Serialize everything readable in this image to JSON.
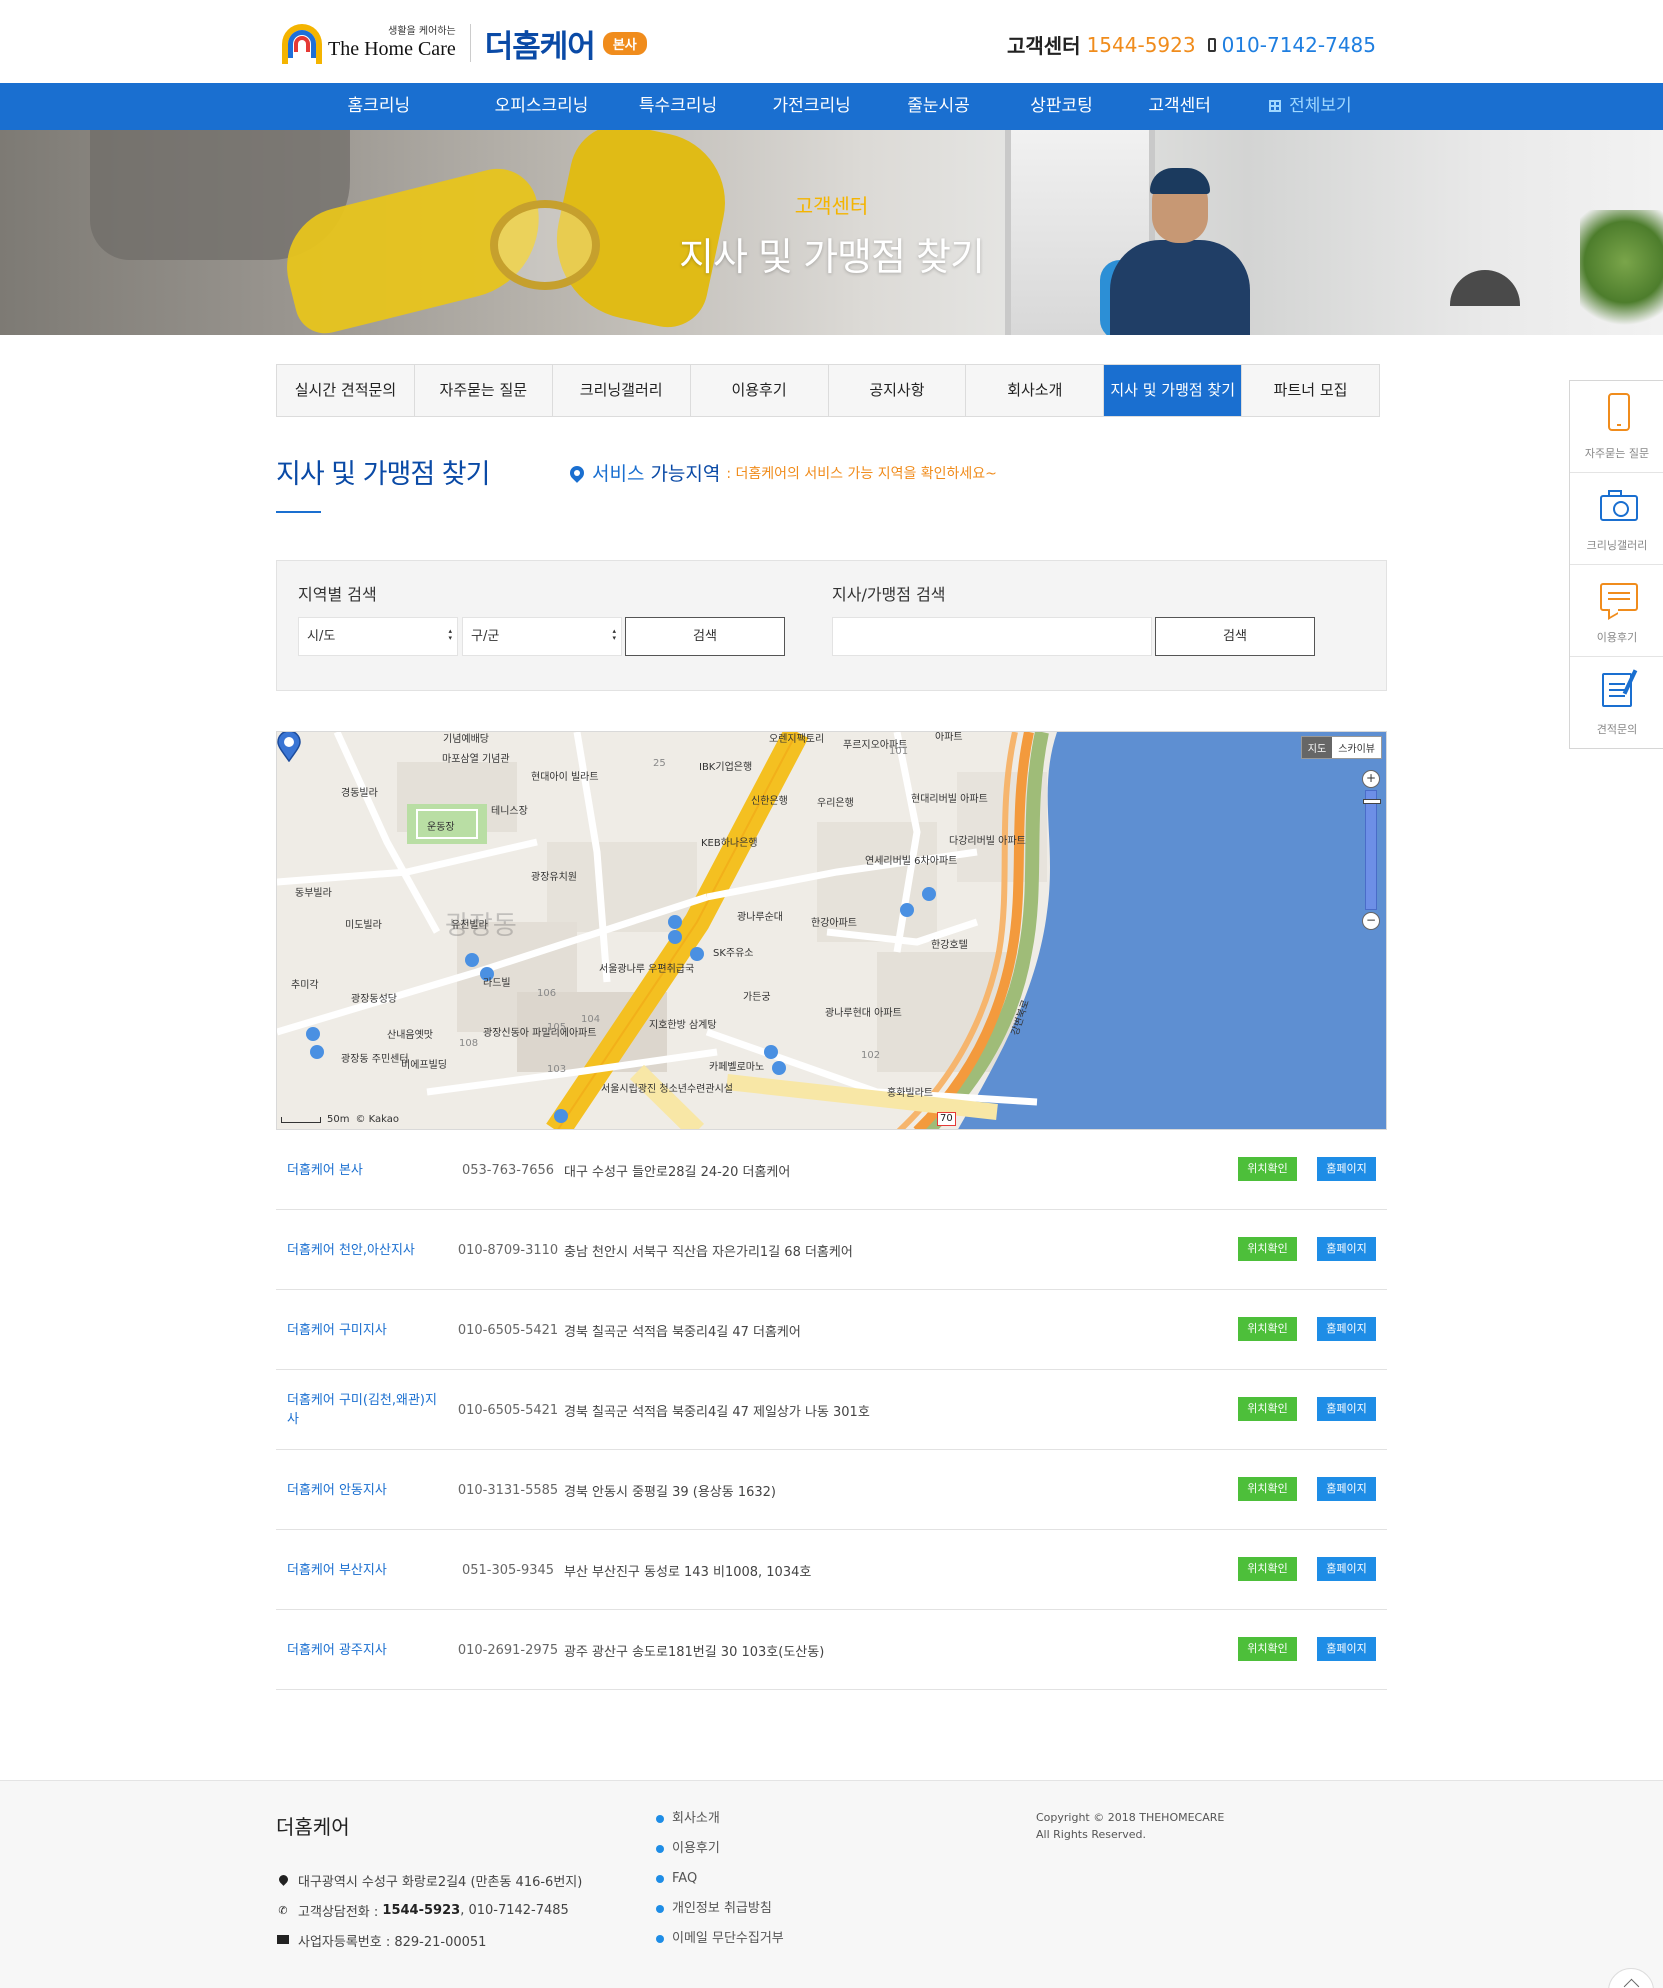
{
  "header": {
    "logo_small": "생활을 케어하는",
    "logo_en": "The Home Care",
    "logo_ko": "더홈케어",
    "logo_badge": "본사",
    "cs_label": "고객센터",
    "cs_number": "1544-5923",
    "cs_mobile": "010-7142-7485"
  },
  "nav": {
    "items": [
      "홈크리닝",
      "오피스크리닝",
      "특수크리닝",
      "가전크리닝",
      "줄눈시공",
      "상판코팅",
      "고객센터"
    ],
    "all_label": "전체보기"
  },
  "banner": {
    "subtitle": "고객센터",
    "title": "지사 및 가맹점 찾기"
  },
  "tabs": [
    "실시간 견적문의",
    "자주묻는 질문",
    "크리닝갤러리",
    "이용후기",
    "공지사항",
    "회사소개",
    "지사 및 가맹점 찾기",
    "파트너 모집"
  ],
  "active_tab": "지사 및 가맹점 찾기",
  "page": {
    "title": "지사 및 가맹점 찾기",
    "service_a": "서비스",
    "service_b": "가능지역",
    "service_desc": ": 더홈케어의 서비스 가능 지역을 확인하세요~"
  },
  "search": {
    "region_label": "지역별 검색",
    "sido": "시/도",
    "gugun": "구/군",
    "search_btn": "검색",
    "branch_label": "지사/가맹점 검색",
    "branch_value": "",
    "branch_btn": "검색"
  },
  "map": {
    "toggle_map": "지도",
    "toggle_sky": "스카이뷰",
    "zoom_in": "+",
    "zoom_out": "−",
    "scale": "50m",
    "copyright": "© Kakao",
    "area_name": "광장동",
    "labels": [
      "기념예배당",
      "마포삼열 기념관",
      "오렌지팩토리",
      "푸르지오아파트",
      "아파트",
      "IBK기업은행",
      "현대아이 빌라트",
      "경동빌라",
      "테니스장",
      "신한은행",
      "우리은행",
      "현대리버빌 아파트",
      "운동장",
      "KEB하나은행",
      "다강리버빌 아파트",
      "연세리버빌 6차아파트",
      "광장유치원",
      "동부빌라",
      "미도빌라",
      "유천빌라",
      "광나루순대",
      "한강아파트",
      "한강호텔",
      "추미각",
      "SK주유소",
      "서울광나루 우편취급국",
      "라드빌",
      "광장동성당",
      "가든궁",
      "광나루현대 아파트",
      "산내음옛맛",
      "광장신동아 파밀리에아파트",
      "지호한방 삼계탕",
      "광장동 주민센터",
      "비에프빌딩",
      "카페벨로마노",
      "서울시립광진 청소년수련관시설",
      "홍화빌라트",
      "강변북로",
      "25",
      "101",
      "103",
      "102",
      "104",
      "105",
      "106",
      "108",
      "70"
    ]
  },
  "branches": [
    {
      "name": "더홈케어 본사",
      "tel": "053-763-7656",
      "addr": "대구 수성구 들안로28길 24-20 더홈케어",
      "loc": "위치확인",
      "home": "홈페이지"
    },
    {
      "name": "더홈케어 천안,아산지사",
      "tel": "010-8709-3110",
      "addr": "충남 천안시 서북구 직산읍 자은가리1길 68 더홈케어",
      "loc": "위치확인",
      "home": "홈페이지"
    },
    {
      "name": "더홈케어 구미지사",
      "tel": "010-6505-5421",
      "addr": "경북 칠곡군 석적읍 북중리4길 47 더홈케어",
      "loc": "위치확인",
      "home": "홈페이지"
    },
    {
      "name": "더홈케어 구미(김천,왜관)지사",
      "tel": "010-6505-5421",
      "addr": "경북 칠곡군 석적읍 북중리4길 47 제일상가 나동 301호",
      "loc": "위치확인",
      "home": "홈페이지"
    },
    {
      "name": "더홈케어 안동지사",
      "tel": "010-3131-5585",
      "addr": "경북 안동시 중평길 39 (용상동 1632)",
      "loc": "위치확인",
      "home": "홈페이지"
    },
    {
      "name": "더홈케어 부산지사",
      "tel": "051-305-9345",
      "addr": "부산 부산진구 동성로 143 비1008, 1034호",
      "loc": "위치확인",
      "home": "홈페이지"
    },
    {
      "name": "더홈케어 광주지사",
      "tel": "010-2691-2975",
      "addr": "광주 광산구 송도로181번길 30 103호(도산동)",
      "loc": "위치확인",
      "home": "홈페이지"
    }
  ],
  "quick": [
    "자주묻는 질문",
    "크리닝갤러리",
    "이용후기",
    "견적문의"
  ],
  "footer": {
    "brand": "더홈케어",
    "address": "대구광역시 수성구 화랑로2길4 (만촌동 416-6번지)",
    "tel_label": "고객상담전화 :",
    "tel_main": "1544-5923",
    "tel_sub": ", 010-7142-7485",
    "biz": "사업자등록번호 : 829-21-00051",
    "links": [
      "회사소개",
      "이용후기",
      "FAQ",
      "개인정보 취급방침",
      "이메일 무단수집거부"
    ],
    "copyright": "Copyright © 2018 THEHOMECARE",
    "rights": "All Rights Reserved."
  },
  "colors": {
    "primary": "#1a6fd0",
    "dark_blue": "#0a4aa6",
    "orange": "#f08c1c",
    "green": "#4dbf3a",
    "button_blue": "#1e8de6"
  }
}
